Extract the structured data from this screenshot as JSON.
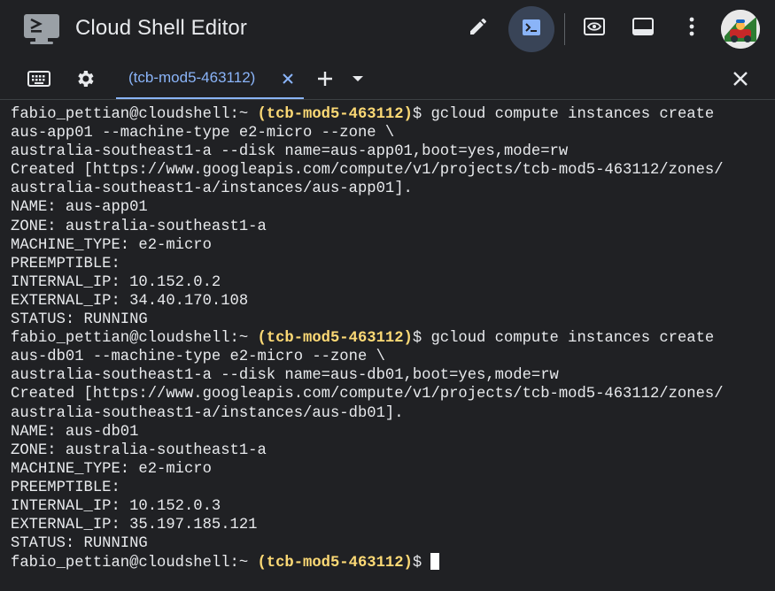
{
  "header": {
    "app_title": "Cloud Shell Editor",
    "icons": [
      "cloud-shell-logo-icon",
      "pencil-icon",
      "terminal-icon",
      "preview-icon",
      "panel-icon",
      "more-vert-icon"
    ]
  },
  "tabs": {
    "active_label": "(tcb-mod5-463112)"
  },
  "terminal": {
    "user": "fabio_pettian@cloudshell:~ ",
    "project": "(tcb-mod5-463112)",
    "prompt_tail": "$ ",
    "lines": [
      {
        "type": "prompt",
        "cmd": "gcloud compute instances create"
      },
      {
        "type": "out",
        "text": "aus-app01 --machine-type e2-micro --zone \\"
      },
      {
        "type": "out",
        "text": "australia-southeast1-a --disk name=aus-app01,boot=yes,mode=rw"
      },
      {
        "type": "out",
        "text": "Created [https://www.googleapis.com/compute/v1/projects/tcb-mod5-463112/zones/"
      },
      {
        "type": "out",
        "text": "australia-southeast1-a/instances/aus-app01]."
      },
      {
        "type": "out",
        "text": "NAME: aus-app01"
      },
      {
        "type": "out",
        "text": "ZONE: australia-southeast1-a"
      },
      {
        "type": "out",
        "text": "MACHINE_TYPE: e2-micro"
      },
      {
        "type": "out",
        "text": "PREEMPTIBLE:"
      },
      {
        "type": "out",
        "text": "INTERNAL_IP: 10.152.0.2"
      },
      {
        "type": "out",
        "text": "EXTERNAL_IP: 34.40.170.108"
      },
      {
        "type": "out",
        "text": "STATUS: RUNNING"
      },
      {
        "type": "prompt",
        "cmd": "gcloud compute instances create"
      },
      {
        "type": "out",
        "text": "aus-db01 --machine-type e2-micro --zone \\"
      },
      {
        "type": "out",
        "text": "australia-southeast1-a --disk name=aus-db01,boot=yes,mode=rw"
      },
      {
        "type": "out",
        "text": "Created [https://www.googleapis.com/compute/v1/projects/tcb-mod5-463112/zones/"
      },
      {
        "type": "out",
        "text": "australia-southeast1-a/instances/aus-db01]."
      },
      {
        "type": "out",
        "text": "NAME: aus-db01"
      },
      {
        "type": "out",
        "text": "ZONE: australia-southeast1-a"
      },
      {
        "type": "out",
        "text": "MACHINE_TYPE: e2-micro"
      },
      {
        "type": "out",
        "text": "PREEMPTIBLE:"
      },
      {
        "type": "out",
        "text": "INTERNAL_IP: 10.152.0.3"
      },
      {
        "type": "out",
        "text": "EXTERNAL_IP: 35.197.185.121"
      },
      {
        "type": "out",
        "text": "STATUS: RUNNING"
      },
      {
        "type": "prompt",
        "cmd": "",
        "cursor": true
      }
    ]
  }
}
